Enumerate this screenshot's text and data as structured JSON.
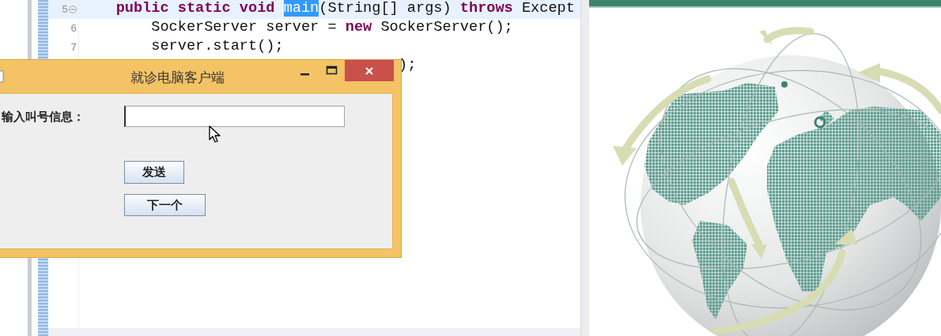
{
  "editor": {
    "lines": [
      {
        "number": "5",
        "fold": true,
        "current": true,
        "segments": [
          {
            "text": "    public static void ",
            "kind": "keyword"
          },
          {
            "text": "main",
            "kind": "highlight"
          },
          {
            "text": "(String[] args) ",
            "kind": "plain"
          },
          {
            "text": "throws",
            "kind": "keyword"
          },
          {
            "text": " Except",
            "kind": "plain"
          }
        ]
      },
      {
        "number": "6",
        "fold": false,
        "current": false,
        "segments": [
          {
            "text": "        SockerServer server = ",
            "kind": "plain"
          },
          {
            "text": "new",
            "kind": "keyword"
          },
          {
            "text": " SockerServer();",
            "kind": "plain"
          }
        ]
      },
      {
        "number": "7",
        "fold": false,
        "current": false,
        "segments": [
          {
            "text": "        server.start();",
            "kind": "plain"
          }
        ]
      },
      {
        "fold": false,
        "current": false,
        "segments": [
          {
            "text": ");",
            "kind": "plain"
          }
        ]
      }
    ]
  },
  "dialog": {
    "title": "就诊电脑客户端",
    "label": "输入叫号信息：",
    "buttons": [
      "发送",
      "下一个"
    ]
  }
}
